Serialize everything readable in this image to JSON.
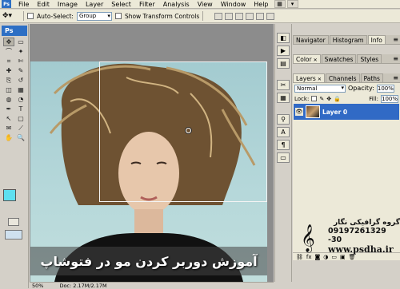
{
  "menu": {
    "items": [
      "File",
      "Edit",
      "Image",
      "Layer",
      "Select",
      "Filter",
      "Analysis",
      "View",
      "Window",
      "Help"
    ],
    "app_icon": "Ps"
  },
  "options": {
    "auto_select_label": "Auto-Select:",
    "auto_select_value": "Group",
    "show_transform_label": "Show Transform Controls"
  },
  "toolbox": {
    "logo": "Ps",
    "tools": [
      "move-tool",
      "marquee-tool",
      "lasso-tool",
      "magic-wand-tool",
      "crop-tool",
      "slice-tool",
      "healing-tool",
      "brush-tool",
      "stamp-tool",
      "history-brush-tool",
      "eraser-tool",
      "gradient-tool",
      "blur-tool",
      "dodge-tool",
      "pen-tool",
      "type-tool",
      "path-select-tool",
      "shape-tool",
      "notes-tool",
      "eyedropper-tool",
      "hand-tool",
      "zoom-tool"
    ],
    "tool_glyphs": [
      "✥",
      "▭",
      "⌒",
      "✦",
      "⌗",
      "✄",
      "✚",
      "✎",
      "⎘",
      "↺",
      "◫",
      "▦",
      "◍",
      "◔",
      "✒",
      "T",
      "↖",
      "▢",
      "✉",
      "⟋",
      "✋",
      "🔍"
    ],
    "foreground_color": "#5fe0f0",
    "background_color": "#5a2a78"
  },
  "canvas": {
    "caption": "آموزش دوربر کردن مو در فتوشاپ"
  },
  "status": {
    "zoom": "50%",
    "doc_info": "Doc: 2.17M/2.17M"
  },
  "panels": {
    "top_tabs": [
      "Navigator",
      "Histogram",
      "Info"
    ],
    "mid_tabs": [
      "Color",
      "Swatches",
      "Styles"
    ],
    "layer_tabs": [
      "Layers",
      "Channels",
      "Paths"
    ],
    "blend_mode": "Normal",
    "opacity_label": "Opacity:",
    "opacity_value": "100%",
    "lock_label": "Lock:",
    "fill_label": "Fill:",
    "fill_value": "100%",
    "layer_name": "Layer 0"
  },
  "watermark": {
    "name": "گروه گرافیکی نگار",
    "phone": "09197261329 -30",
    "url": "www.psdha.ir"
  }
}
